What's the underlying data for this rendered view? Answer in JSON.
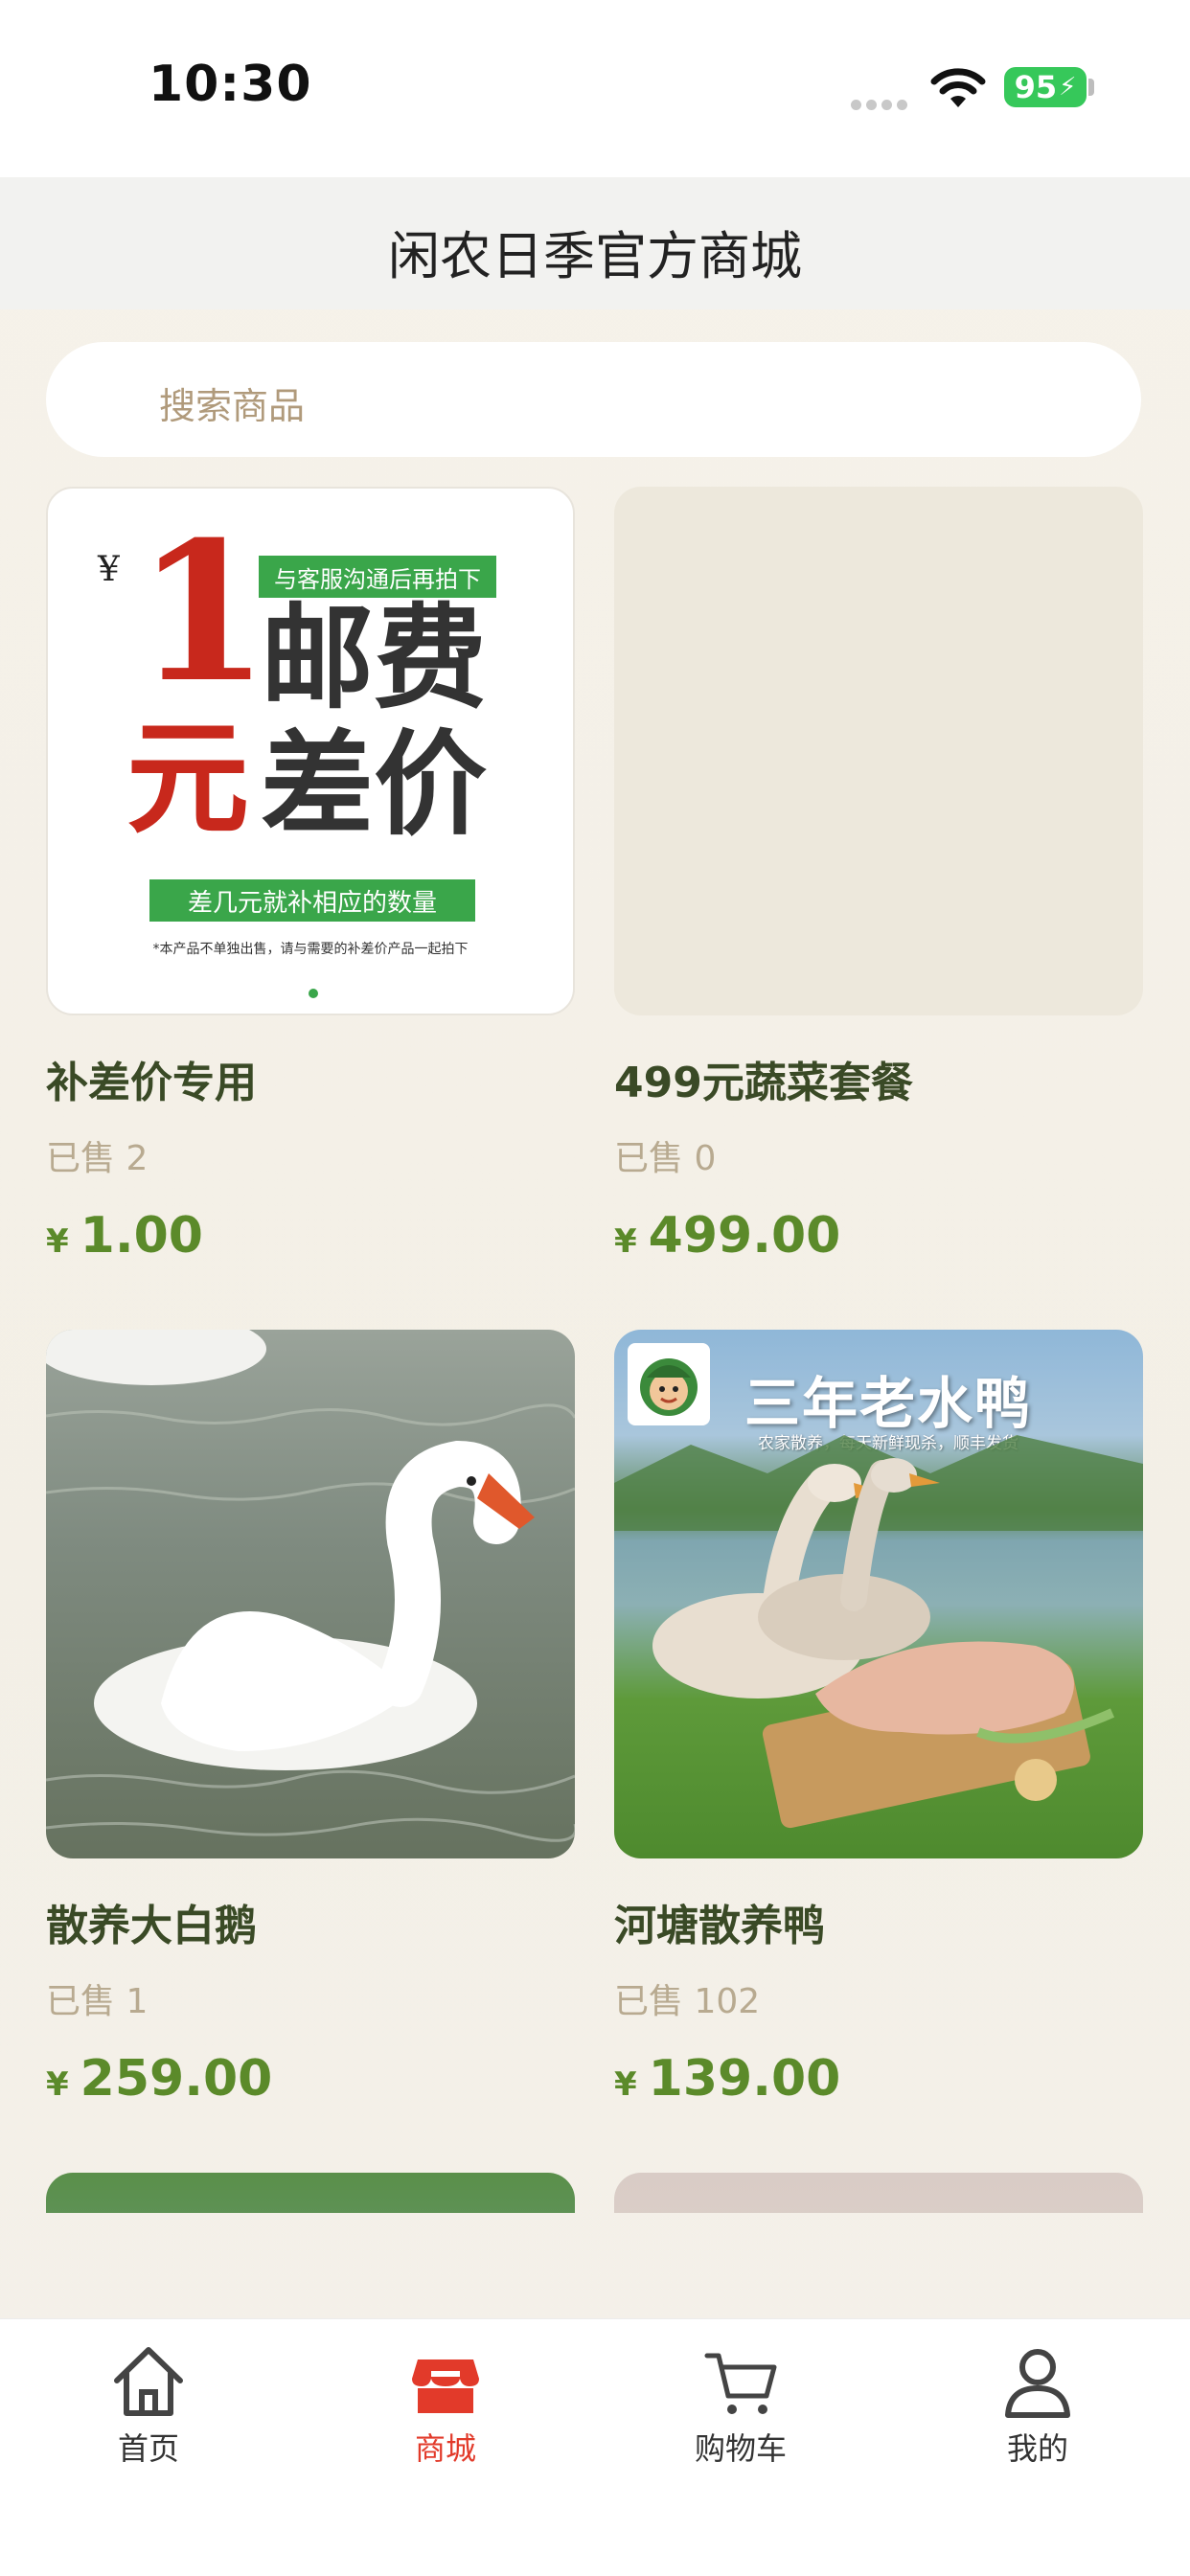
{
  "status_bar": {
    "time": "10:30",
    "battery": "95"
  },
  "header": {
    "title": "闲农日季官方商城"
  },
  "search": {
    "placeholder": "搜索商品"
  },
  "banner": {
    "yen": "¥",
    "one": "1",
    "yuan": "元",
    "tag_top": "与客服沟通后再拍下",
    "line1": "邮费",
    "line2": "差价",
    "tag_bottom": "差几元就补相应的数量",
    "note": "*本产品不单独出售，请与需要的补差价产品一起拍下"
  },
  "duck_banner": {
    "title": "三年老水鸭",
    "subtitle": "农家散养，每天新鲜现杀，顺丰发货"
  },
  "products": [
    {
      "title": "补差价专用",
      "sold": "已售 2",
      "currency": "¥",
      "price": "1.00"
    },
    {
      "title": "499元蔬菜套餐",
      "sold": "已售 0",
      "currency": "¥",
      "price": "499.00"
    },
    {
      "title": "散养大白鹅",
      "sold": "已售 1",
      "currency": "¥",
      "price": "259.00"
    },
    {
      "title": "河塘散养鸭",
      "sold": "已售 102",
      "currency": "¥",
      "price": "139.00"
    }
  ],
  "tabbar": {
    "items": [
      {
        "label": "首页",
        "icon": "home-icon"
      },
      {
        "label": "商城",
        "icon": "shop-icon",
        "active": true
      },
      {
        "label": "购物车",
        "icon": "cart-icon"
      },
      {
        "label": "我的",
        "icon": "user-icon"
      }
    ]
  },
  "colors": {
    "accent": "#e23a2a",
    "price": "#5b8a2a",
    "title": "#3a4a26",
    "banner_green": "#3aa64a",
    "banner_red": "#c8281c"
  }
}
